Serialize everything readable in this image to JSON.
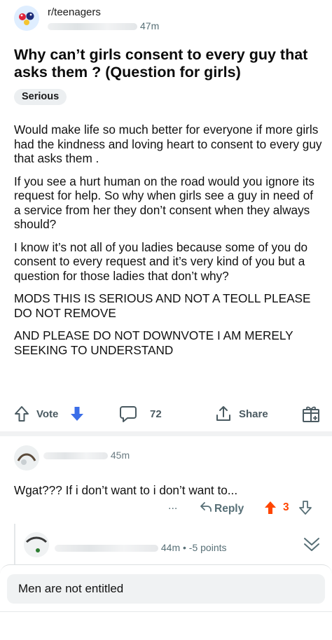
{
  "post": {
    "subreddit": "r/teenagers",
    "time": "47m",
    "title": "Why can’t girls consent to every guy that asks them ? (Question for girls)",
    "flair": "Serious",
    "paragraphs": [
      "Would make life so much better for everyone if more girls had the kindness and loving heart to consent to every guy that asks them .",
      "If you see a hurt human on the road would you ignore its request for help. So why when girls see a guy in need of a service from her they don’t consent when they always should?",
      "I know it’s not all of you ladies because some of you do consent to every request and it’s very kind of you but a question for those ladies that don’t why?",
      "MODS THIS IS SERIOUS AND NOT A TEOLL PLEASE DO NOT REMOVE",
      "AND PLEASE DO NOT DOWNVOTE I AM MERELY SEEKING TO UNDERSTAND"
    ]
  },
  "actions": {
    "vote_label": "Vote",
    "comment_count": "72",
    "share_label": "Share"
  },
  "comments": [
    {
      "time": "45m",
      "text": "Wgat??? If i don’t want to i don’t want to...",
      "more": "...",
      "reply_label": "Reply",
      "score": "3"
    },
    {
      "meta": "44m • -5 points"
    }
  ],
  "reply_input": {
    "value": "Men are not entitled"
  },
  "colors": {
    "upvote": "#ff4500",
    "downvote": "#3b6ee8",
    "muted": "#576f76"
  },
  "icons": [
    "subreddit-avatar-icon",
    "arrow-up-icon",
    "arrow-down-icon",
    "comment-bubble-icon",
    "share-icon",
    "award-icon",
    "more-dots-icon",
    "reply-arrow-icon",
    "collapse-chevron-icon"
  ]
}
